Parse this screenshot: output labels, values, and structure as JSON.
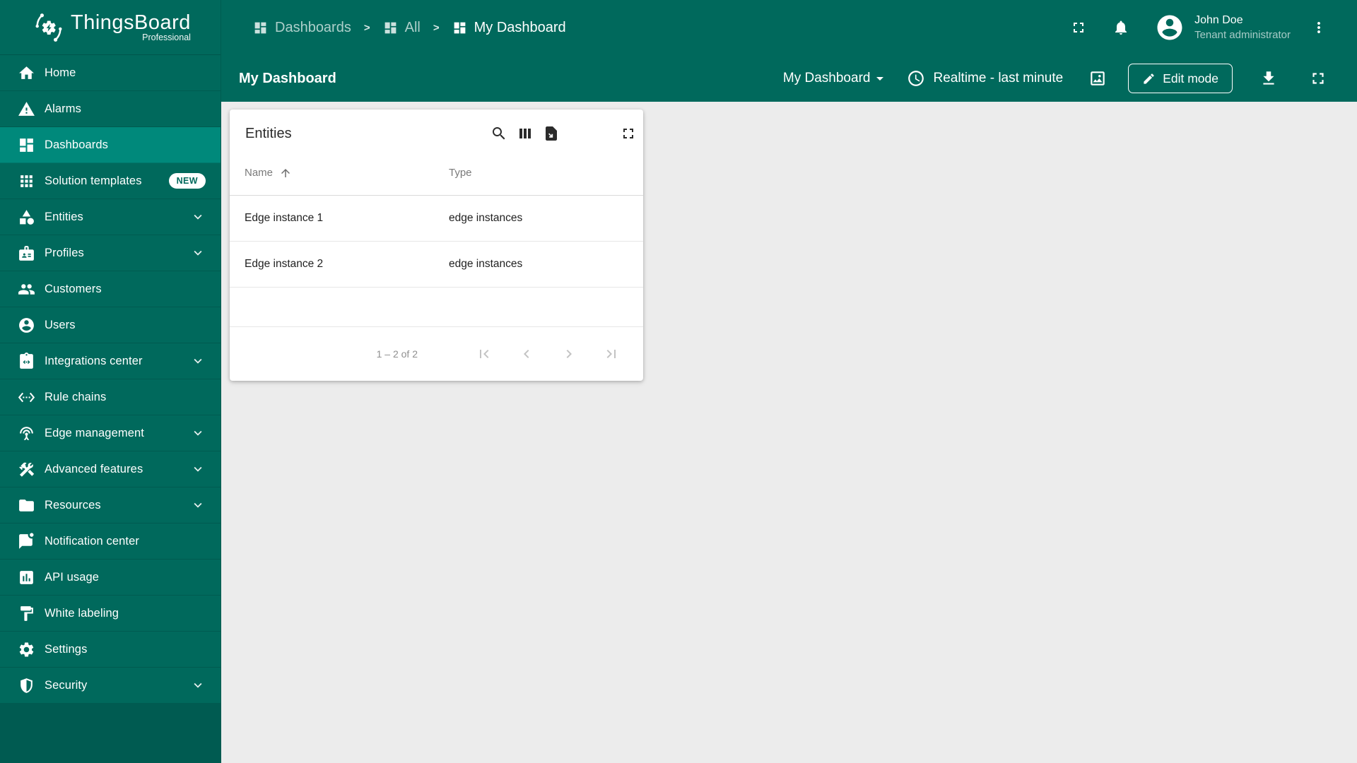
{
  "app": {
    "brand": "ThingsBoard",
    "brand_edition": "Professional"
  },
  "sidebar": {
    "items": [
      {
        "label": "Home",
        "icon": "home-icon"
      },
      {
        "label": "Alarms",
        "icon": "alarm-warning-icon"
      },
      {
        "label": "Dashboards",
        "icon": "dashboards-icon",
        "active": true
      },
      {
        "label": "Solution templates",
        "icon": "solution-templates-icon",
        "badge": "NEW"
      },
      {
        "label": "Entities",
        "icon": "entities-icon",
        "expandable": true
      },
      {
        "label": "Profiles",
        "icon": "profiles-icon",
        "expandable": true
      },
      {
        "label": "Customers",
        "icon": "customers-icon"
      },
      {
        "label": "Users",
        "icon": "users-icon"
      },
      {
        "label": "Integrations center",
        "icon": "integrations-icon",
        "expandable": true
      },
      {
        "label": "Rule chains",
        "icon": "rule-chains-icon"
      },
      {
        "label": "Edge management",
        "icon": "edge-management-icon",
        "expandable": true
      },
      {
        "label": "Advanced features",
        "icon": "advanced-features-icon",
        "expandable": true
      },
      {
        "label": "Resources",
        "icon": "resources-icon",
        "expandable": true
      },
      {
        "label": "Notification center",
        "icon": "notification-center-icon"
      },
      {
        "label": "API usage",
        "icon": "api-usage-icon"
      },
      {
        "label": "White labeling",
        "icon": "white-labeling-icon"
      },
      {
        "label": "Settings",
        "icon": "settings-icon"
      },
      {
        "label": "Security",
        "icon": "security-icon",
        "expandable": true
      }
    ]
  },
  "breadcrumb": {
    "separator": ">",
    "items": [
      {
        "label": "Dashboards",
        "icon": "dashboard-icon"
      },
      {
        "label": "All",
        "icon": "dashboard-icon"
      },
      {
        "label": "My Dashboard",
        "icon": "dashboard-icon",
        "current": true
      }
    ]
  },
  "topbar": {
    "user": {
      "name": "John Doe",
      "role": "Tenant administrator"
    }
  },
  "toolbar": {
    "title": "My Dashboard",
    "state_select_value": "My Dashboard",
    "timewindow_label": "Realtime - last minute",
    "edit_button_label": "Edit mode"
  },
  "widget": {
    "title": "Entities",
    "table": {
      "columns": [
        "Name",
        "Type"
      ],
      "sort": {
        "column": "Name",
        "direction": "asc"
      },
      "rows": [
        [
          "Edge instance 1",
          "edge instances"
        ],
        [
          "Edge instance 2",
          "edge instances"
        ]
      ]
    },
    "pagination": {
      "range_label": "1 – 2 of 2"
    }
  },
  "colors": {
    "primary": "#00695c",
    "sidebar_active": "#00897b",
    "sidebar_footer": "#005b51",
    "content_bg": "#ececec",
    "badge_text": "#00695c"
  }
}
